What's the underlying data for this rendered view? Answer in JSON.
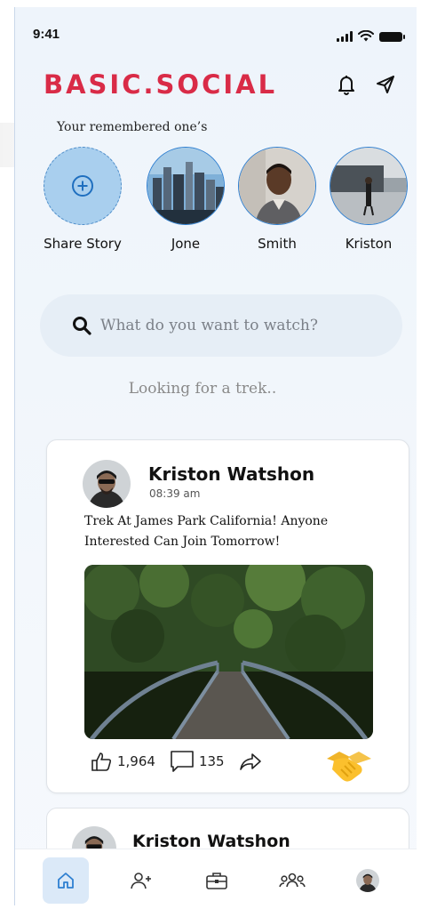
{
  "status_bar": {
    "time": "9:41"
  },
  "header": {
    "brand": "BASIC.SOCIAL",
    "icons": [
      "bell-icon",
      "send-icon"
    ],
    "brand_color": "#d92b47"
  },
  "stories": {
    "title": "Your remembered one’s",
    "items": [
      {
        "label": "Share Story",
        "icon": "add-circle-icon"
      },
      {
        "label": "Jone"
      },
      {
        "label": "Smith"
      },
      {
        "label": "Kriston"
      }
    ]
  },
  "search": {
    "placeholder": "What do you want to watch?"
  },
  "hint": "Looking for a trek..",
  "feed": {
    "posts": [
      {
        "author": "Kriston Watshon",
        "time": "08:39 am",
        "text": "Trek At James Park California! Anyone Interested Can Join Tomorrow!",
        "likes": "1,964",
        "comments": "135"
      },
      {
        "author": "Kriston Watshon"
      }
    ]
  },
  "nav": {
    "items": [
      "home-icon",
      "add-user-icon",
      "briefcase-icon",
      "group-icon",
      "profile-avatar"
    ],
    "active": "home-icon",
    "accent": "#2e7fd1"
  }
}
